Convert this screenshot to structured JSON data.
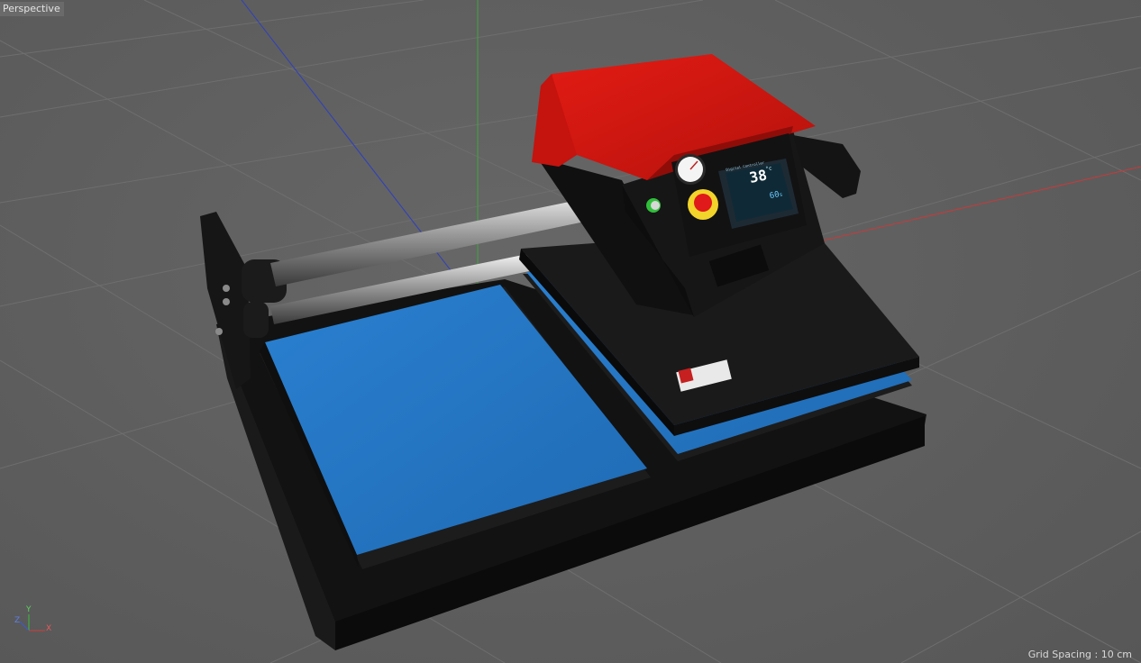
{
  "viewport": {
    "view_label": "Perspective",
    "grid_spacing_text": "Grid Spacing : 10 cm"
  },
  "axes_gizmo": {
    "x": "X",
    "y": "Y",
    "z": "Z"
  },
  "model": {
    "display": {
      "title": "Digital Controller",
      "temperature": "38",
      "temp_unit": "°c",
      "secondary_value": "60",
      "secondary_unit": "s"
    },
    "colors": {
      "cover": "#d01510",
      "platen": "#2a7fcf",
      "body": "#141414",
      "stop_button": "#e0191a",
      "ring": "#f2d42a",
      "green_button": "#2fbf3a"
    }
  },
  "icons": [
    "perspective-view-icon",
    "axis-gizmo-icon",
    "gauge-icon",
    "emergency-stop-icon",
    "power-button-icon"
  ]
}
